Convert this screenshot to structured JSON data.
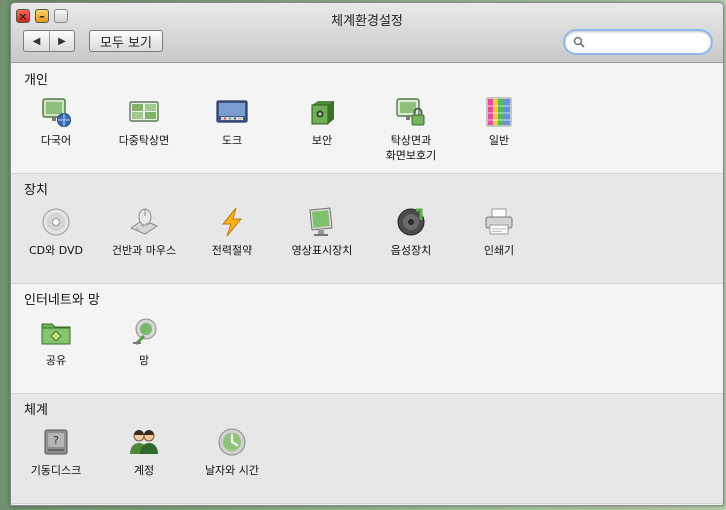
{
  "window": {
    "title": "체계환경설정",
    "show_all_label": "모두 보기",
    "search": {
      "value": "",
      "placeholder": ""
    }
  },
  "sections": [
    {
      "title": "개인",
      "items": [
        {
          "label": "다국어",
          "icon": "language-icon"
        },
        {
          "label": "다중탁상면",
          "icon": "spaces-icon"
        },
        {
          "label": "도크",
          "icon": "dock-icon"
        },
        {
          "label": "보안",
          "icon": "security-icon"
        },
        {
          "label": "탁상면과 화면보호기",
          "icon": "desktop-screensaver-icon"
        },
        {
          "label": "일반",
          "icon": "general-icon"
        }
      ]
    },
    {
      "title": "장치",
      "items": [
        {
          "label": "CD와 DVD",
          "icon": "cd-dvd-icon"
        },
        {
          "label": "건반과 마우스",
          "icon": "keyboard-mouse-icon"
        },
        {
          "label": "전력절약",
          "icon": "energy-saver-icon"
        },
        {
          "label": "영상표시장치",
          "icon": "display-icon"
        },
        {
          "label": "음성장치",
          "icon": "sound-icon"
        },
        {
          "label": "인쇄기",
          "icon": "printer-icon"
        }
      ]
    },
    {
      "title": "인터네트와 망",
      "items": [
        {
          "label": "공유",
          "icon": "sharing-icon"
        },
        {
          "label": "망",
          "icon": "network-icon"
        }
      ]
    },
    {
      "title": "체계",
      "items": [
        {
          "label": "기동디스크",
          "icon": "startup-disk-icon"
        },
        {
          "label": "계정",
          "icon": "accounts-icon"
        },
        {
          "label": "날자와 시간",
          "icon": "date-time-icon"
        }
      ]
    }
  ]
}
